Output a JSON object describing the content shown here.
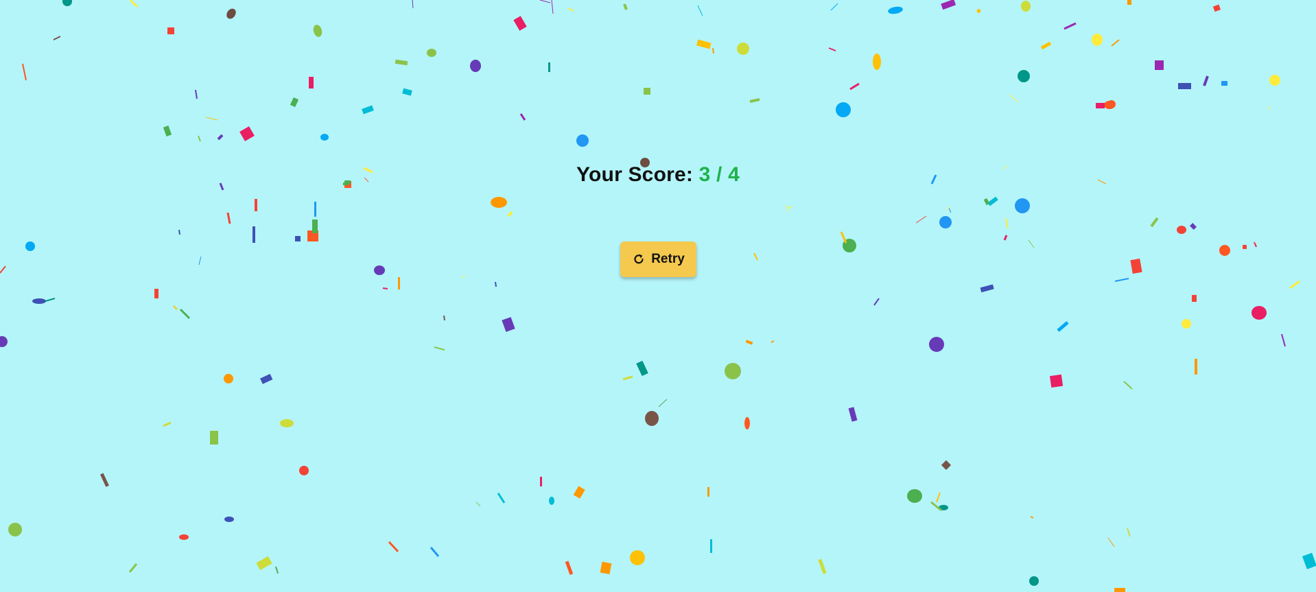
{
  "result": {
    "score_label": "Your Score:",
    "score_value": "3 / 4",
    "score_color": "#1fb34a"
  },
  "actions": {
    "retry_label": "Retry",
    "retry_icon": "refresh-icon"
  },
  "theme": {
    "background": "#b4f5fa",
    "button_color": "#f5c84e"
  }
}
